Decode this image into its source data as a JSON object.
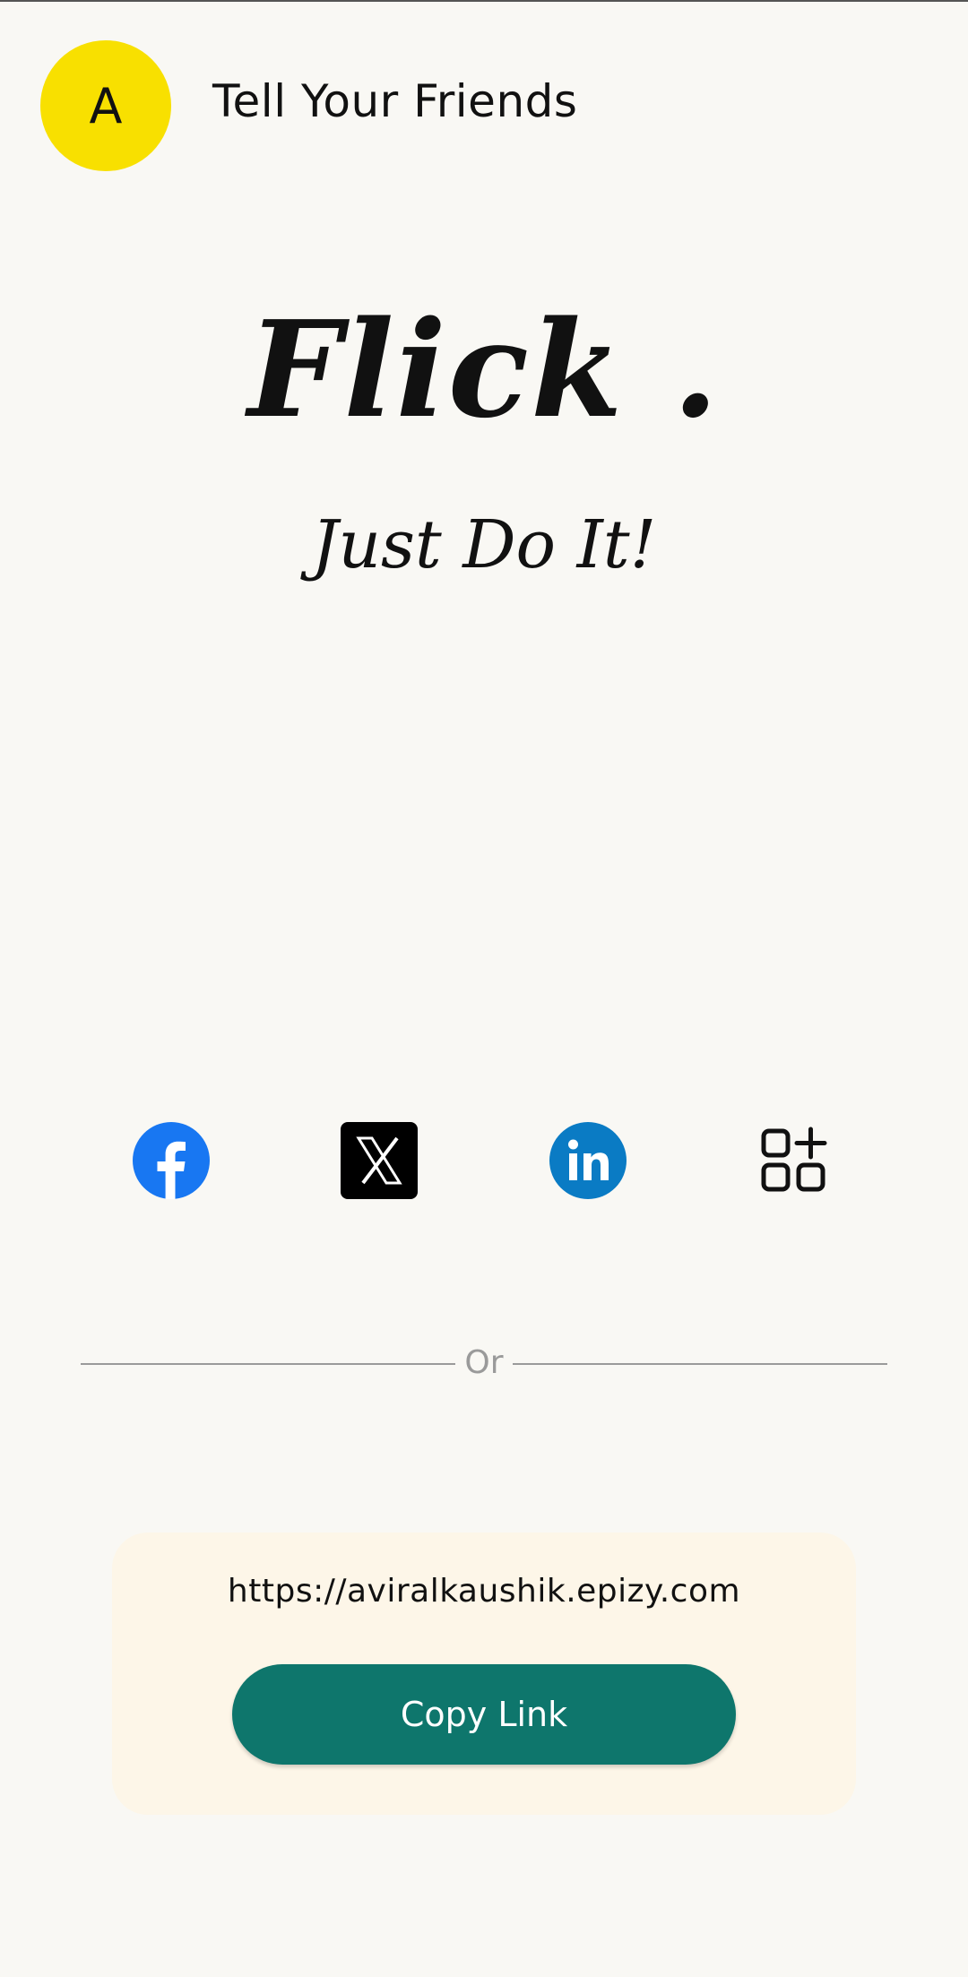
{
  "header": {
    "avatar_letter": "A",
    "title": "Tell Your Friends"
  },
  "brand": {
    "name": "Flick .",
    "tagline": "Just Do It!"
  },
  "share": {
    "icons": [
      "facebook-icon",
      "x-twitter-icon",
      "linkedin-icon",
      "more-apps-icon"
    ]
  },
  "divider": {
    "label": "Or"
  },
  "link_card": {
    "url": "https://aviralkaushik.epizy.com",
    "copy_label": "Copy Link"
  },
  "colors": {
    "background": "#f9f8f4",
    "avatar": "#f8e000",
    "facebook": "#1877f2",
    "linkedin": "#0a7bc4",
    "copy_button": "#0e766c",
    "card": "#fdf6e8"
  }
}
